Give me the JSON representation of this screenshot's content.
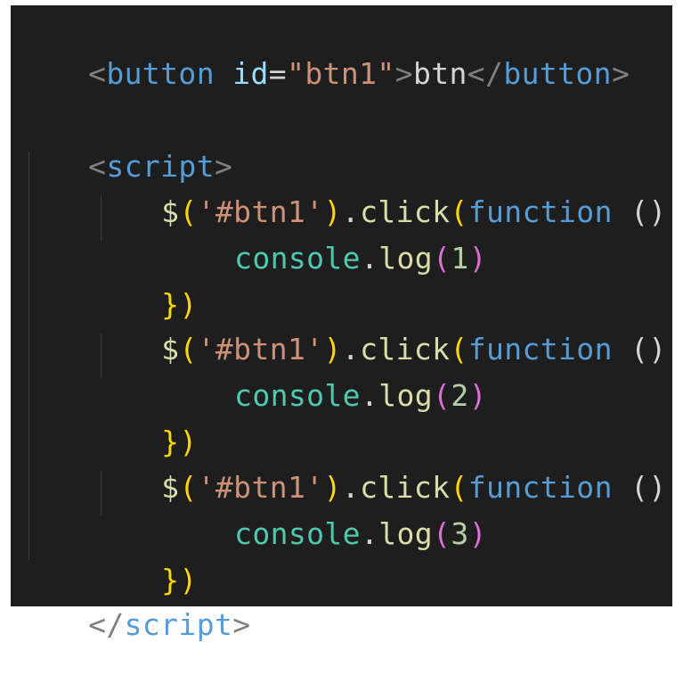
{
  "code": {
    "button_line": {
      "open_bracket": "<",
      "tag": "button",
      "space": " ",
      "attr_name": "id",
      "equals": "=",
      "attr_value": "\"btn1\"",
      "close_bracket": ">",
      "text": "btn",
      "end_open": "</",
      "end_tag": "button",
      "end_close": ">"
    },
    "script_open": {
      "open_bracket": "<",
      "tag": "script",
      "close_bracket": ">"
    },
    "handlers": [
      {
        "dollar": "$",
        "lparen": "(",
        "selector": "'#btn1'",
        "rparen": ")",
        "dot": ".",
        "method": "click",
        "args_open": "(",
        "keyword": "function",
        "params": " () ",
        "brace_open": "{",
        "body_obj": "console",
        "body_dot": ".",
        "body_fn": "log",
        "body_lparen": "(",
        "body_arg": "1",
        "body_rparen": ")",
        "close": "})"
      },
      {
        "dollar": "$",
        "lparen": "(",
        "selector": "'#btn1'",
        "rparen": ")",
        "dot": ".",
        "method": "click",
        "args_open": "(",
        "keyword": "function",
        "params": " () ",
        "brace_open": "{",
        "body_obj": "console",
        "body_dot": ".",
        "body_fn": "log",
        "body_lparen": "(",
        "body_arg": "2",
        "body_rparen": ")",
        "close": "})"
      },
      {
        "dollar": "$",
        "lparen": "(",
        "selector": "'#btn1'",
        "rparen": ")",
        "dot": ".",
        "method": "click",
        "args_open": "(",
        "keyword": "function",
        "params": " () ",
        "brace_open": "{",
        "body_obj": "console",
        "body_dot": ".",
        "body_fn": "log",
        "body_lparen": "(",
        "body_arg": "3",
        "body_rparen": ")",
        "close": "})"
      }
    ],
    "script_close": {
      "open_bracket": "</",
      "tag": "script",
      "close_bracket": ">"
    }
  },
  "colors": {
    "background": "#1e1e1e",
    "tag": "#569cd6",
    "tag_punct": "#808080",
    "attribute": "#9cdcfe",
    "string": "#ce9178",
    "function": "#dcdcaa",
    "keyword": "#569cd6",
    "object": "#4ec9b0",
    "number": "#b5cea8",
    "brace": "#ffd700",
    "paren": "#da70d6"
  }
}
